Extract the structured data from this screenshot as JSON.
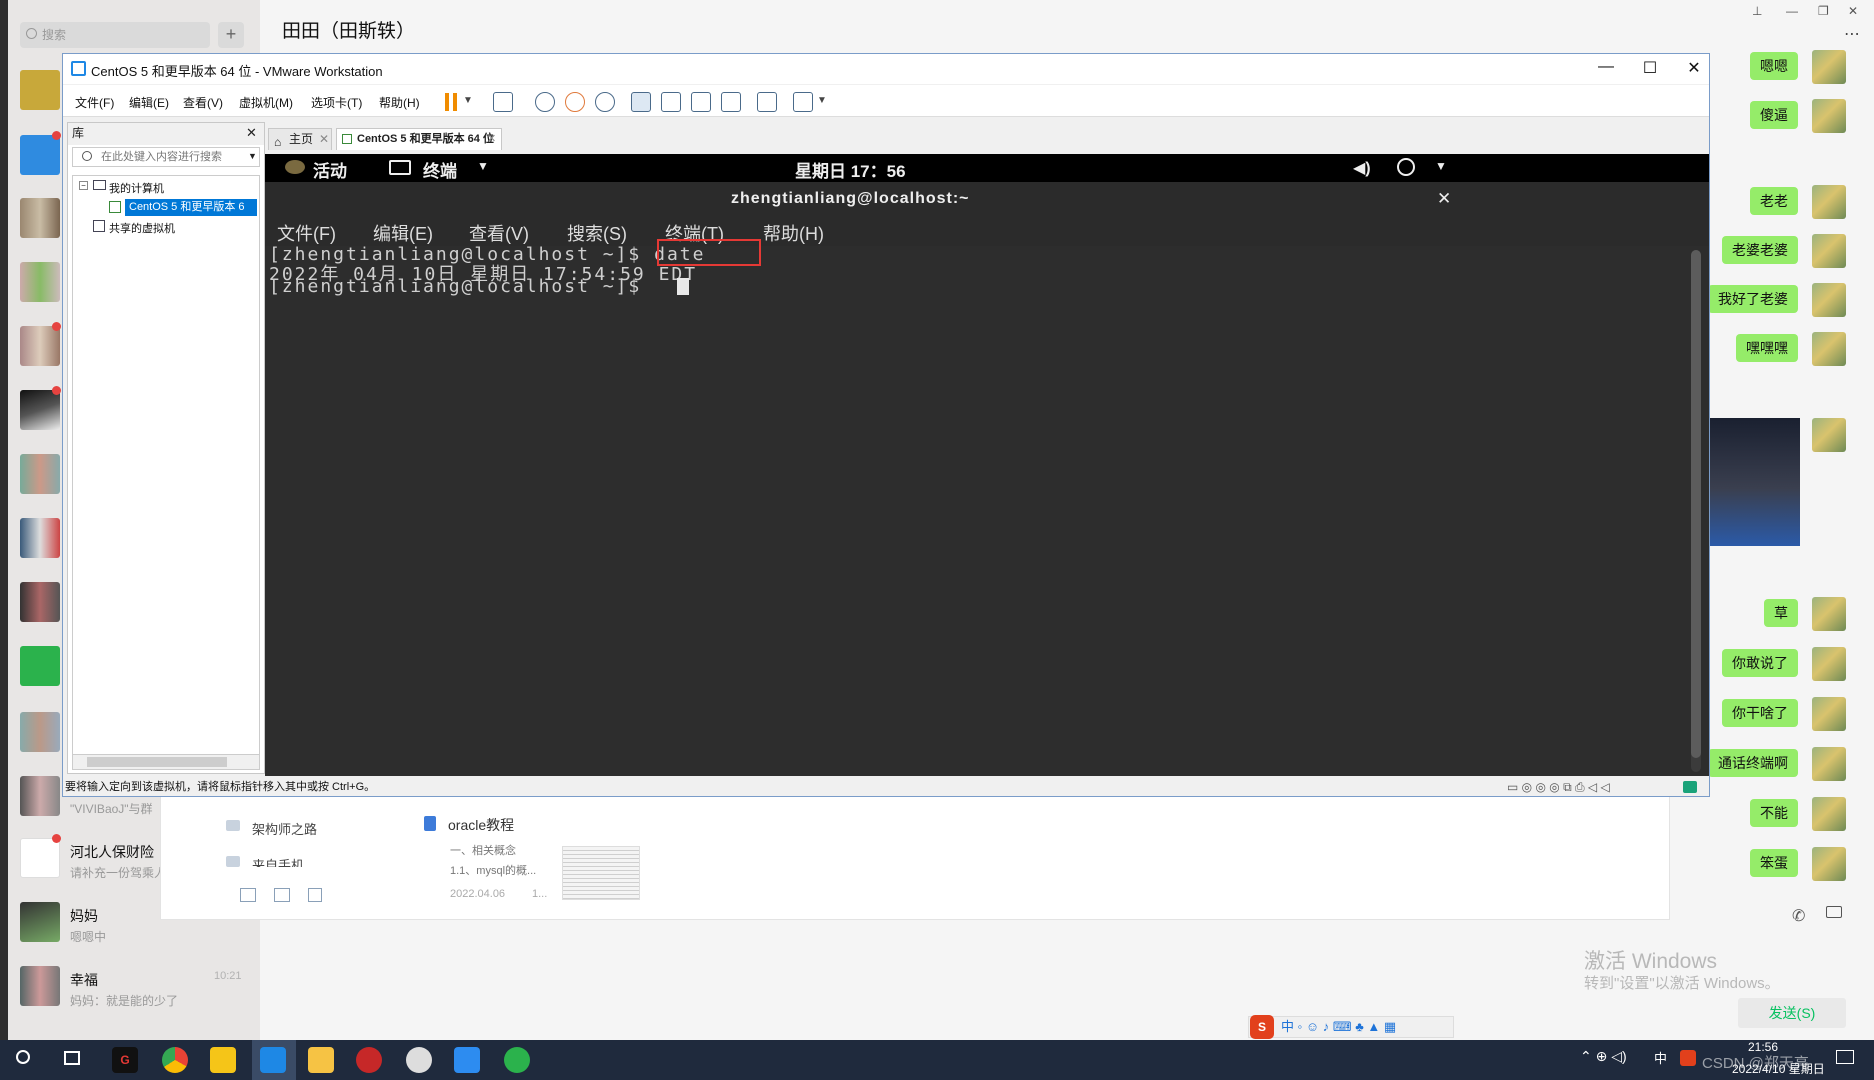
{
  "wechat": {
    "search_placeholder": "搜索",
    "chat_title": "田田（田斯轶）",
    "contacts": [
      {
        "name": "河北人保财险",
        "snippet": "请补充一份驾乘人",
        "time": ""
      },
      {
        "name": "妈妈",
        "snippet": "嗯嗯中",
        "time": ""
      },
      {
        "name": "幸福",
        "snippet": "妈妈：就是能的少了",
        "time": "10:21"
      }
    ],
    "partial_snippet": "\"VIVIBaoJ\"与群",
    "messages": [
      {
        "text": "嗯嗯"
      },
      {
        "text": "傻逼"
      },
      {
        "text": "老老"
      },
      {
        "text": "老婆老婆"
      },
      {
        "text": "我好了老婆"
      },
      {
        "text": "嘿嘿嘿"
      },
      {
        "text": "草"
      },
      {
        "text": "你敢说了"
      },
      {
        "text": "你干啥了"
      },
      {
        "text": "通话终端啊"
      },
      {
        "text": "不能"
      },
      {
        "text": "笨蛋"
      }
    ],
    "send_label": "发送(S)",
    "activate_title": "激活 Windows",
    "activate_sub": "转到\"设置\"以激活 Windows。"
  },
  "doc_panel": {
    "folders": [
      "架构师之路",
      "来自手机"
    ],
    "doc_title": "oracle教程",
    "doc_line1": "一、相关概念",
    "doc_line2": "1.1、mysql的概...",
    "doc_date": "2022.04.06",
    "doc_extra": "1..."
  },
  "vmware": {
    "title": "CentOS 5 和更早版本 64 位 - VMware Workstation",
    "menu": [
      "文件(F)",
      "编辑(E)",
      "查看(V)",
      "虚拟机(M)",
      "选项卡(T)",
      "帮助(H)"
    ],
    "library_label": "库",
    "library_search": "在此处键入内容进行搜索",
    "tree_my_computer": "我的计算机",
    "tree_vm": "CentOS 5 和更早版本 6",
    "tree_shared": "共享的虚拟机",
    "tab_home": "主页",
    "tab_vm": "CentOS 5 和更早版本 64 位",
    "status": "要将输入定向到该虚拟机，请将鼠标指针移入其中或按 Ctrl+G。"
  },
  "guest": {
    "activities": "活动",
    "app_name": "终端",
    "clock": "星期日 17：56",
    "terminal_title": "zhengtianliang@localhost:~",
    "terminal_menu": [
      "文件(F)",
      "编辑(E)",
      "查看(V)",
      "搜索(S)",
      "终端(T)",
      "帮助(H)"
    ],
    "lines": [
      "[zhengtianliang@localhost ~]$ date",
      "2022年 04月 10日 星期日 17:54:59 EDT",
      "[zhengtianliang@localhost ~]$ "
    ],
    "highlight_color": "#e53935"
  },
  "taskbar": {
    "time": "21:56",
    "date": "2022/4/10 星期日",
    "ime": "中",
    "watermark": "CSDN @郑天亮"
  }
}
